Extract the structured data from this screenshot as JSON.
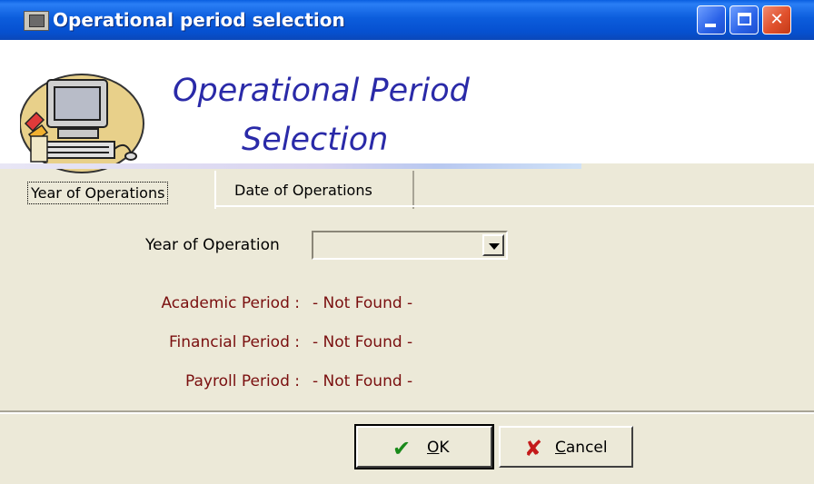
{
  "window": {
    "title": "Operational period selection"
  },
  "banner": {
    "line1": "Operational Period",
    "line2": "Selection"
  },
  "tabs": [
    {
      "label": "Year of Operations",
      "active": true
    },
    {
      "label": "Date of Operations",
      "active": false
    }
  ],
  "form": {
    "year_label": "Year of Operation",
    "year_value": ""
  },
  "periods": [
    {
      "label": "Academic Period :",
      "value": "- Not Found -"
    },
    {
      "label": "Financial Period :",
      "value": "- Not Found -"
    },
    {
      "label": "Payroll Period :",
      "value": "- Not Found -"
    }
  ],
  "buttons": {
    "ok": "OK",
    "cancel": "Cancel"
  },
  "icons": {
    "title": "window-app-icon",
    "banner": "computer-logo-icon",
    "ok": "checkmark-icon",
    "cancel": "x-icon"
  },
  "colors": {
    "titlebar": "#0a5fe0",
    "period_text": "#7a0f0f",
    "banner_text": "#2a2aa8",
    "ok_icon": "#1a8a1a",
    "cancel_icon": "#c41a1a"
  }
}
